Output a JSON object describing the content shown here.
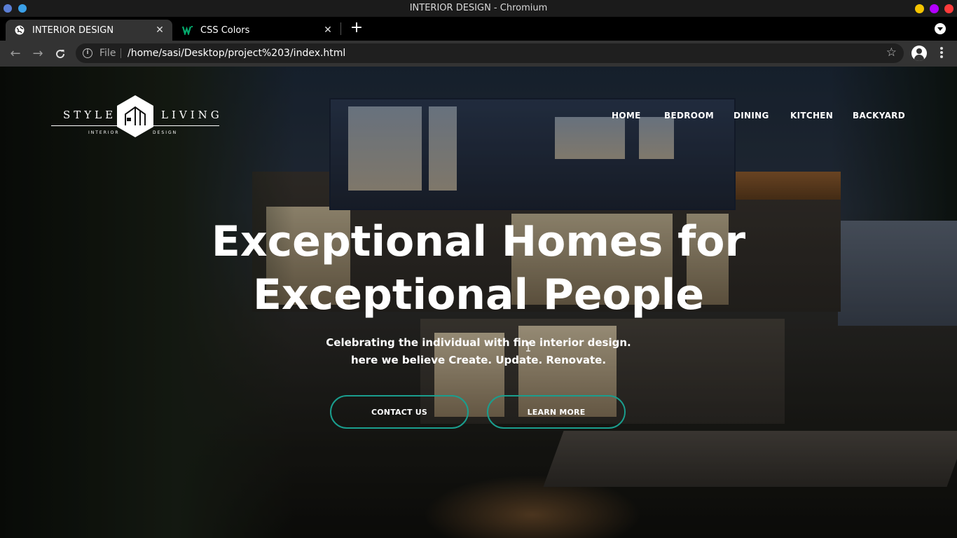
{
  "window": {
    "title": "INTERIOR DESIGN - Chromium",
    "controls": {
      "minimize_color": "#f5c400",
      "maximize_color": "#b300ff",
      "close_color": "#ff3b3b"
    }
  },
  "tabs": [
    {
      "label": "INTERIOR DESIGN",
      "icon": "globe-icon",
      "active": true
    },
    {
      "label": "CSS Colors",
      "icon": "w3schools-icon",
      "active": false
    }
  ],
  "toolbar": {
    "scheme": "File",
    "url": "/home/sasi/Desktop/project%203/index.html"
  },
  "site": {
    "logo": {
      "left_word": "STYLE",
      "right_word": "LIVING",
      "sub_left": "INTERIOR",
      "sub_right": "DESIGN"
    },
    "nav": [
      "HOME",
      "BEDROOM",
      "DINING",
      "KITCHEN",
      "BACKYARD"
    ],
    "headline": [
      "Exceptional Homes for",
      "Exceptional People"
    ],
    "subtitle": [
      "Celebrating the individual with fine interior design.",
      "here we believe Create. Update. Renovate."
    ],
    "buttons": {
      "contact": "CONTACT US",
      "learn": "LEARN MORE"
    },
    "accent_color": "#1a9e8e"
  }
}
